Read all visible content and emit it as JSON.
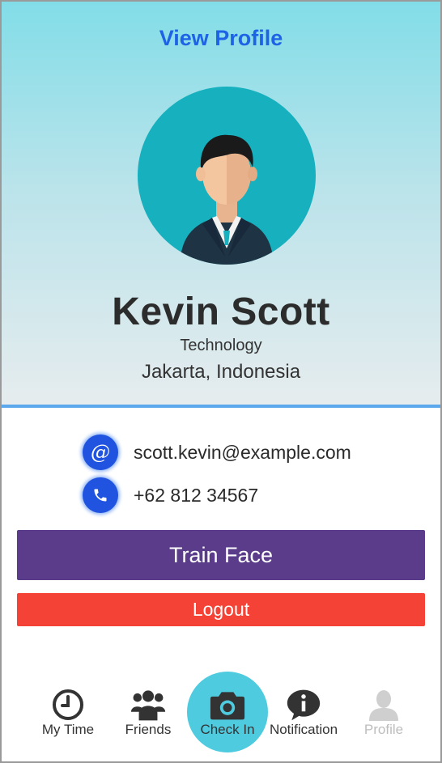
{
  "header": {
    "title": "View Profile"
  },
  "profile": {
    "name": "Kevin Scott",
    "department": "Technology",
    "location": "Jakarta, Indonesia",
    "avatar_icon": "person-avatar"
  },
  "contact": {
    "email": "scott.kevin@example.com",
    "email_icon": "at-icon",
    "phone": "+62 812 34567",
    "phone_icon": "phone-icon"
  },
  "actions": {
    "train_face_label": "Train Face",
    "logout_label": "Logout"
  },
  "nav": {
    "items": [
      {
        "label": "My Time",
        "icon": "clock-icon",
        "state": "normal"
      },
      {
        "label": "Friends",
        "icon": "friends-icon",
        "state": "normal"
      },
      {
        "label": "Check In",
        "icon": "camera-icon",
        "state": "highlighted"
      },
      {
        "label": "Notification",
        "icon": "info-icon",
        "state": "normal"
      },
      {
        "label": "Profile",
        "icon": "profile-icon",
        "state": "disabled"
      }
    ]
  },
  "colors": {
    "title": "#1e63e6",
    "accent_blue": "#1f53e0",
    "train_face": "#5a3c8a",
    "logout": "#f44336",
    "nav_highlight": "#4fcbe0",
    "divider": "#5ca8ec"
  }
}
